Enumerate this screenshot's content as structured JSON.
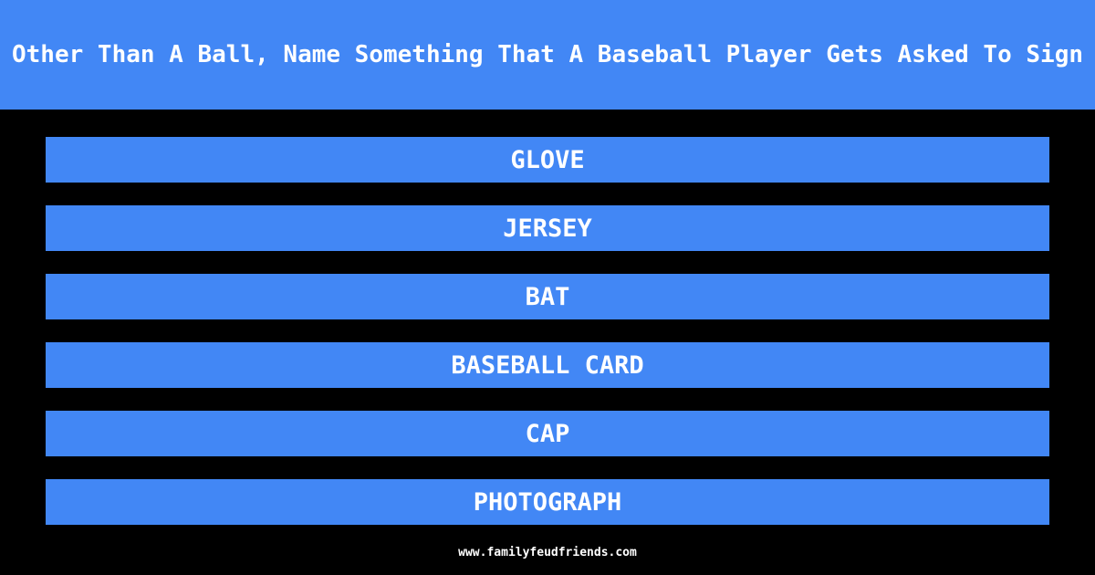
{
  "question": "Other Than A Ball, Name Something That A Baseball Player Gets Asked To Sign",
  "answers": [
    "GLOVE",
    "JERSEY",
    "BAT",
    "BASEBALL CARD",
    "CAP",
    "PHOTOGRAPH"
  ],
  "footer": "www.familyfeudfriends.com",
  "colors": {
    "accent": "#4287f5",
    "background": "#000000"
  }
}
